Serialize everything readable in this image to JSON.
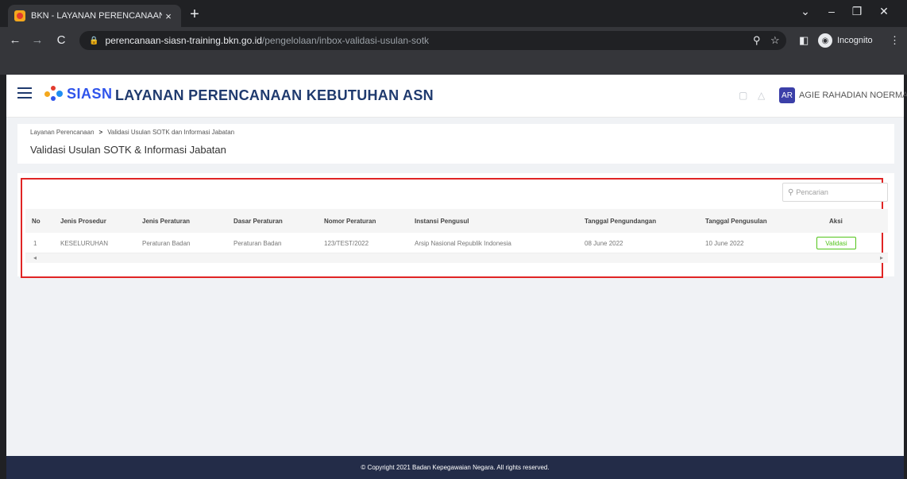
{
  "browser": {
    "tab_title": "BKN - LAYANAN PERENCANAAN",
    "tab_close": "×",
    "new_tab": "+",
    "url_host": "perencanaan-siasn-training.bkn.go.id",
    "url_path": "/pengelolaan/inbox-validasi-usulan-sotk",
    "incognito_label": "Incognito",
    "window_controls": [
      "⌄",
      "–",
      "❐",
      "✕"
    ]
  },
  "header": {
    "logo_text": "SIASN",
    "app_title": "LAYANAN PERENCANAAN KEBUTUHAN ASN",
    "avatar_initials": "AR",
    "user_name": "AGIE RAHADIAN NOERMAN"
  },
  "breadcrumb": {
    "items": [
      "Layanan Perencanaan",
      "Validasi Usulan SOTK dan Informasi Jabatan"
    ],
    "separator": ">"
  },
  "page": {
    "title": "Validasi Usulan SOTK & Informasi Jabatan"
  },
  "search": {
    "placeholder": "Pencarian"
  },
  "table": {
    "columns": [
      "No",
      "Jenis Prosedur",
      "Jenis Peraturan",
      "Dasar Peraturan",
      "Nomor Peraturan",
      "Instansi Pengusul",
      "Tanggal Pengundangan",
      "Tanggal Pengusulan",
      "Aksi"
    ],
    "rows": [
      {
        "no": "1",
        "jenis_prosedur": "KESELURUHAN",
        "jenis_peraturan": "Peraturan Badan",
        "dasar_peraturan": "Peraturan Badan",
        "nomor_peraturan": "123/TEST/2022",
        "instansi_pengusul": "Arsip Nasional Republik Indonesia",
        "tanggal_pengundangan": "08 June 2022",
        "tanggal_pengusulan": "10 June 2022",
        "aksi_label": "Validasi"
      }
    ]
  },
  "footer": {
    "copyright": "© Copyright 2021 Badan Kepegawaian Negara. All rights reserved."
  },
  "colors": {
    "brand_blue": "#2f54eb",
    "title_navy": "#1f3a6e",
    "footer_bg": "#232c48",
    "highlight_red": "#e02424",
    "validasi_green": "#52c41a"
  }
}
